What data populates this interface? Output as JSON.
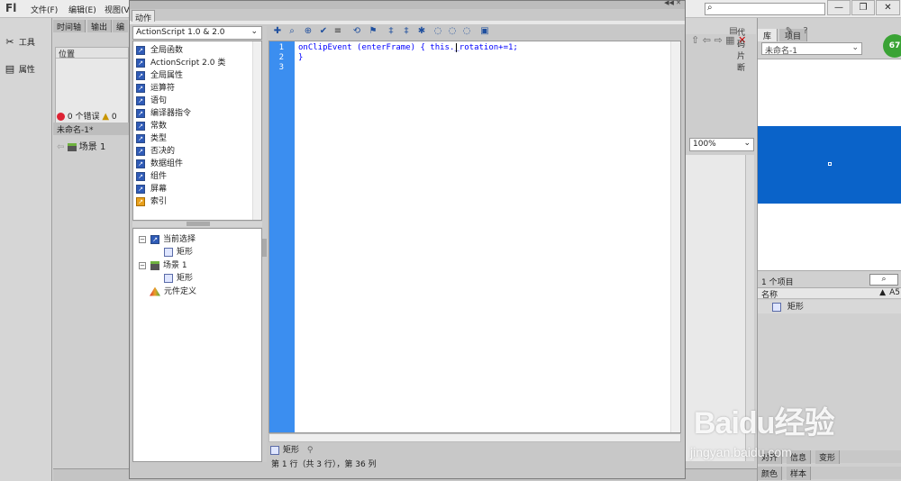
{
  "app": {
    "logo": "Fl"
  },
  "menu": {
    "items": [
      "文件(F)",
      "编辑(E)",
      "视图(V"
    ]
  },
  "window_controls": {
    "minimize": "—",
    "restore": "❐",
    "close": "✕"
  },
  "left_tools": {
    "tools_label": "工具",
    "props_label": "属性"
  },
  "timeline": {
    "tabs": [
      "时间轴",
      "输出",
      "编"
    ],
    "position_header": "位置",
    "errors": "0 个错误",
    "warnings": "0",
    "doc_tab": "未命名-1*",
    "scene": "场景 1"
  },
  "actions_panel": {
    "tab": "动作",
    "version": "ActionScript 1.0 & 2.0",
    "categories": [
      "全局函数",
      "ActionScript 2.0 类",
      "全局属性",
      "运算符",
      "语句",
      "编译器指令",
      "常数",
      "类型",
      "否决的",
      "数据组件",
      "组件",
      "屏幕",
      "索引"
    ],
    "tree": {
      "current_selection": "当前选择",
      "current_child": "矩形",
      "scene": "场景 1",
      "scene_child": "矩形",
      "symbol_defs": "元件定义"
    },
    "code_snippet": "代码片断",
    "lines": [
      "1",
      "2",
      "3"
    ],
    "code": [
      "onClipEvent (enterFrame) { this._rotation+=1;",
      "}",
      ""
    ],
    "bottom_tab": "矩形",
    "status": "第 1 行（共 3 行），第 36 列"
  },
  "stage": {
    "zoom": "100%"
  },
  "library": {
    "tabs": [
      "库",
      "项目"
    ],
    "doc": "未命名-1",
    "item_count": "1 个项目",
    "name_header": "名称",
    "name_header_extra": "A5",
    "item": "矩形",
    "bottom_tabs1": [
      "对齐",
      "信息",
      "变形"
    ],
    "bottom_tabs2": [
      "颜色",
      "样本"
    ],
    "badge": "67",
    "colors": {
      "preview_fill": "#0a63c9"
    }
  },
  "watermark": {
    "brand": "Baidu经验",
    "site": "jingyan.baidu.com"
  }
}
